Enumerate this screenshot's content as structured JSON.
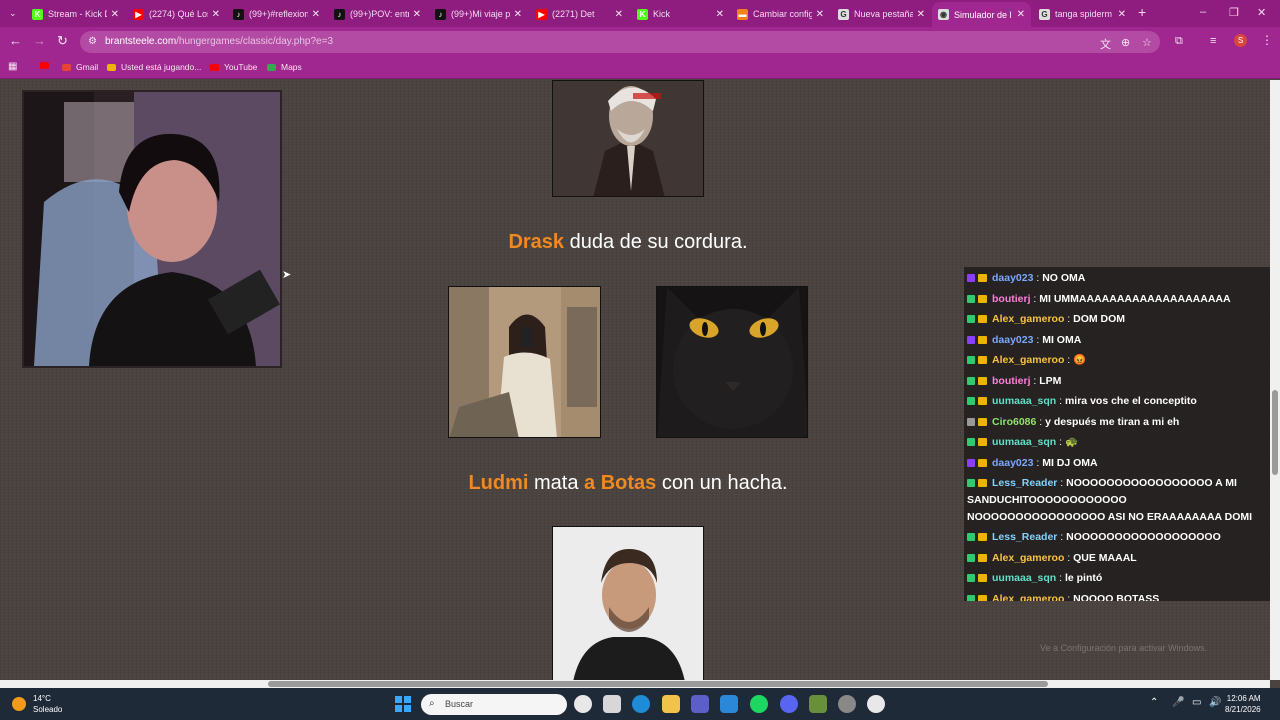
{
  "browser": {
    "tabs": [
      {
        "label": "Stream - Kick D",
        "color": "#53fc18",
        "glyph": "K",
        "active": false
      },
      {
        "label": "(2274) Qué Los",
        "color": "#ff0000",
        "glyph": "▶",
        "active": false
      },
      {
        "label": "(99+)#reflexion",
        "color": "#111111",
        "glyph": "♪",
        "active": false
      },
      {
        "label": "(99+)POV: entr",
        "color": "#111111",
        "glyph": "♪",
        "active": false
      },
      {
        "label": "(99+)Mi viaje p",
        "color": "#111111",
        "glyph": "♪",
        "active": false
      },
      {
        "label": "(2271) Det",
        "color": "#ff0000",
        "glyph": "▶",
        "active": false
      },
      {
        "label": "Kick",
        "color": "#53fc18",
        "glyph": "K",
        "active": false
      },
      {
        "label": "Cambiar config",
        "color": "#f48120",
        "glyph": "▬",
        "active": false
      },
      {
        "label": "Nueva pestaña",
        "color": "#dddddd",
        "glyph": "G",
        "active": false
      },
      {
        "label": "Simulador de l",
        "color": "#dddddd",
        "glyph": "◉",
        "active": true
      },
      {
        "label": "tanga spiderm",
        "color": "#dddddd",
        "glyph": "G",
        "active": false
      }
    ],
    "new_tab": "+",
    "window_controls": [
      "–",
      "❐",
      "✕"
    ],
    "url_domain": "brantsteele.com",
    "url_path": "/hungergames/classic/day.php?e=3",
    "profile_initial": "S",
    "bookmarks": [
      {
        "label": "",
        "color": "#ff0000"
      },
      {
        "label": "Gmail",
        "color": "#ea4335"
      },
      {
        "label": "Usted está jugando...",
        "color": "#f0b400"
      },
      {
        "label": "YouTube",
        "color": "#ff0000"
      },
      {
        "label": "Maps",
        "color": "#34a853"
      }
    ],
    "accent": "#a0278f"
  },
  "events": [
    {
      "parts": [
        {
          "t": "Drask",
          "hl": true
        },
        {
          "t": " duda de su cordura.",
          "hl": false
        }
      ]
    },
    {
      "parts": [
        {
          "t": "Ludmi",
          "hl": true
        },
        {
          "t": " mata ",
          "hl": false
        },
        {
          "t": "a Botas",
          "hl": true
        },
        {
          "t": " con un hacha.",
          "hl": false
        }
      ]
    }
  ],
  "chat": [
    {
      "user": "daay023",
      "color": "#7aa8ff",
      "badge": "#8a3cff",
      "text": "NO OMA"
    },
    {
      "user": "boutierj",
      "color": "#ff7fd6",
      "badge": "#2ecc71",
      "text": "MI UMMAAAAAAAAAAAAAAAAAAAA"
    },
    {
      "user": "Alex_gameroo",
      "color": "#f6c344",
      "badge": "#2ecc71",
      "text": "DOM DOM"
    },
    {
      "user": "daay023",
      "color": "#7aa8ff",
      "badge": "#8a3cff",
      "text": "MI OMA"
    },
    {
      "user": "Alex_gameroo",
      "color": "#f6c344",
      "badge": "#2ecc71",
      "text": "😡"
    },
    {
      "user": "boutierj",
      "color": "#ff7fd6",
      "badge": "#2ecc71",
      "text": "LPM"
    },
    {
      "user": "uumaaa_sqn",
      "color": "#5fe0c8",
      "badge": "#2ecc71",
      "text": "mira vos che el conceptito"
    },
    {
      "user": "Ciro6086",
      "color": "#8fe36b",
      "badge": "#999999",
      "text": "y después me tiran a mi eh"
    },
    {
      "user": "uumaaa_sqn",
      "color": "#5fe0c8",
      "badge": "#2ecc71",
      "text": "🐢"
    },
    {
      "user": "daay023",
      "color": "#7aa8ff",
      "badge": "#8a3cff",
      "text": "MI DJ OMA"
    },
    {
      "user": "Less_Reader",
      "color": "#7fd3ff",
      "badge": "#2ecc71",
      "text": "NOOOOOOOOOOOOOOOOO A MI SANDUCHITOOOOOOOOOOOO NOOOOOOOOOOOOOOOO ASI NO ERAAAAAAAA DOMI"
    },
    {
      "user": "Less_Reader",
      "color": "#7fd3ff",
      "badge": "#2ecc71",
      "text": "NOOOOOOOOOOOOOOOOOO"
    },
    {
      "user": "Alex_gameroo",
      "color": "#f6c344",
      "badge": "#2ecc71",
      "text": "QUE MAAAL"
    },
    {
      "user": "uumaaa_sqn",
      "color": "#5fe0c8",
      "badge": "#2ecc71",
      "text": "le pintó"
    },
    {
      "user": "Alex_gameroo",
      "color": "#f6c344",
      "badge": "#2ecc71",
      "text": "NOOOO BOTASS"
    }
  ],
  "chat_watermark": "Ve a Configuración para activar Windows.",
  "taskbar": {
    "temp": "14°C",
    "weather": "Soleado",
    "search_placeholder": "Buscar",
    "time": "12:06 AM",
    "date": "8/21/2026"
  }
}
